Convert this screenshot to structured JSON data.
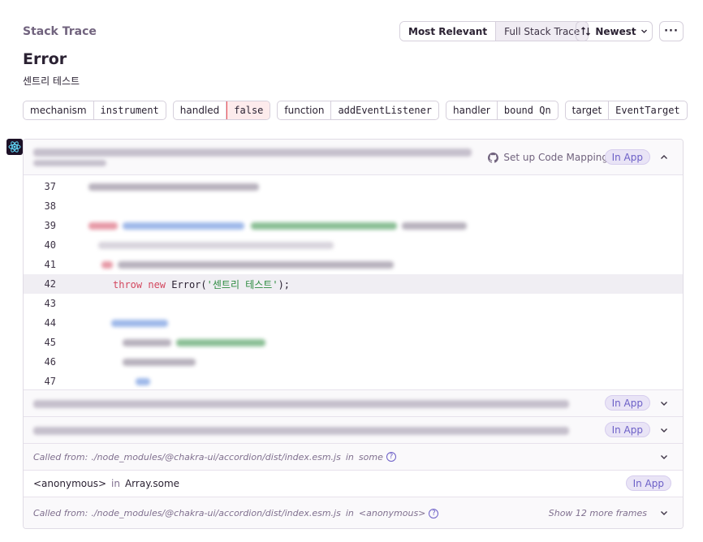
{
  "header": {
    "section_title": "Stack Trace",
    "view_options": [
      "Most Relevant",
      "Full Stack Trace"
    ],
    "active_view": "Most Relevant",
    "sort_label": "Newest",
    "more_label": "···"
  },
  "exception": {
    "type": "Error",
    "message": "센트리 테스트"
  },
  "tags": [
    {
      "key": "mechanism",
      "value": "instrument"
    },
    {
      "key": "handled",
      "value": "false"
    },
    {
      "key": "function",
      "value": "addEventListener"
    },
    {
      "key": "handler",
      "value": "bound Qn"
    },
    {
      "key": "target",
      "value": "EventTarget"
    }
  ],
  "frames": {
    "code_mapping_label": "Set up Code Mapping",
    "in_app_label": "In App",
    "line_numbers": [
      "37",
      "38",
      "39",
      "40",
      "41",
      "42",
      "43",
      "44",
      "45",
      "46",
      "47"
    ],
    "active_line_code": {
      "kw1": "throw",
      "kw2": "new",
      "fn": "Error(",
      "str": "'센트리 테스트'",
      "end": ");"
    },
    "called_from_1": {
      "prefix": "Called from:",
      "path": "./node_modules/@chakra-ui/accordion/dist/index.esm.js",
      "in": "in",
      "fn": "some"
    },
    "anon_frame": {
      "fn": "<anonymous>",
      "in": "in",
      "module": "Array.some"
    },
    "called_from_2": {
      "prefix": "Called from:",
      "path": "./node_modules/@chakra-ui/accordion/dist/index.esm.js",
      "in": "in",
      "fn": "<anonymous>",
      "show_more": "Show 12 more frames"
    }
  },
  "colors": {
    "accent": "#6c5fc7",
    "danger": "#f55459",
    "muted": "#71637e"
  }
}
